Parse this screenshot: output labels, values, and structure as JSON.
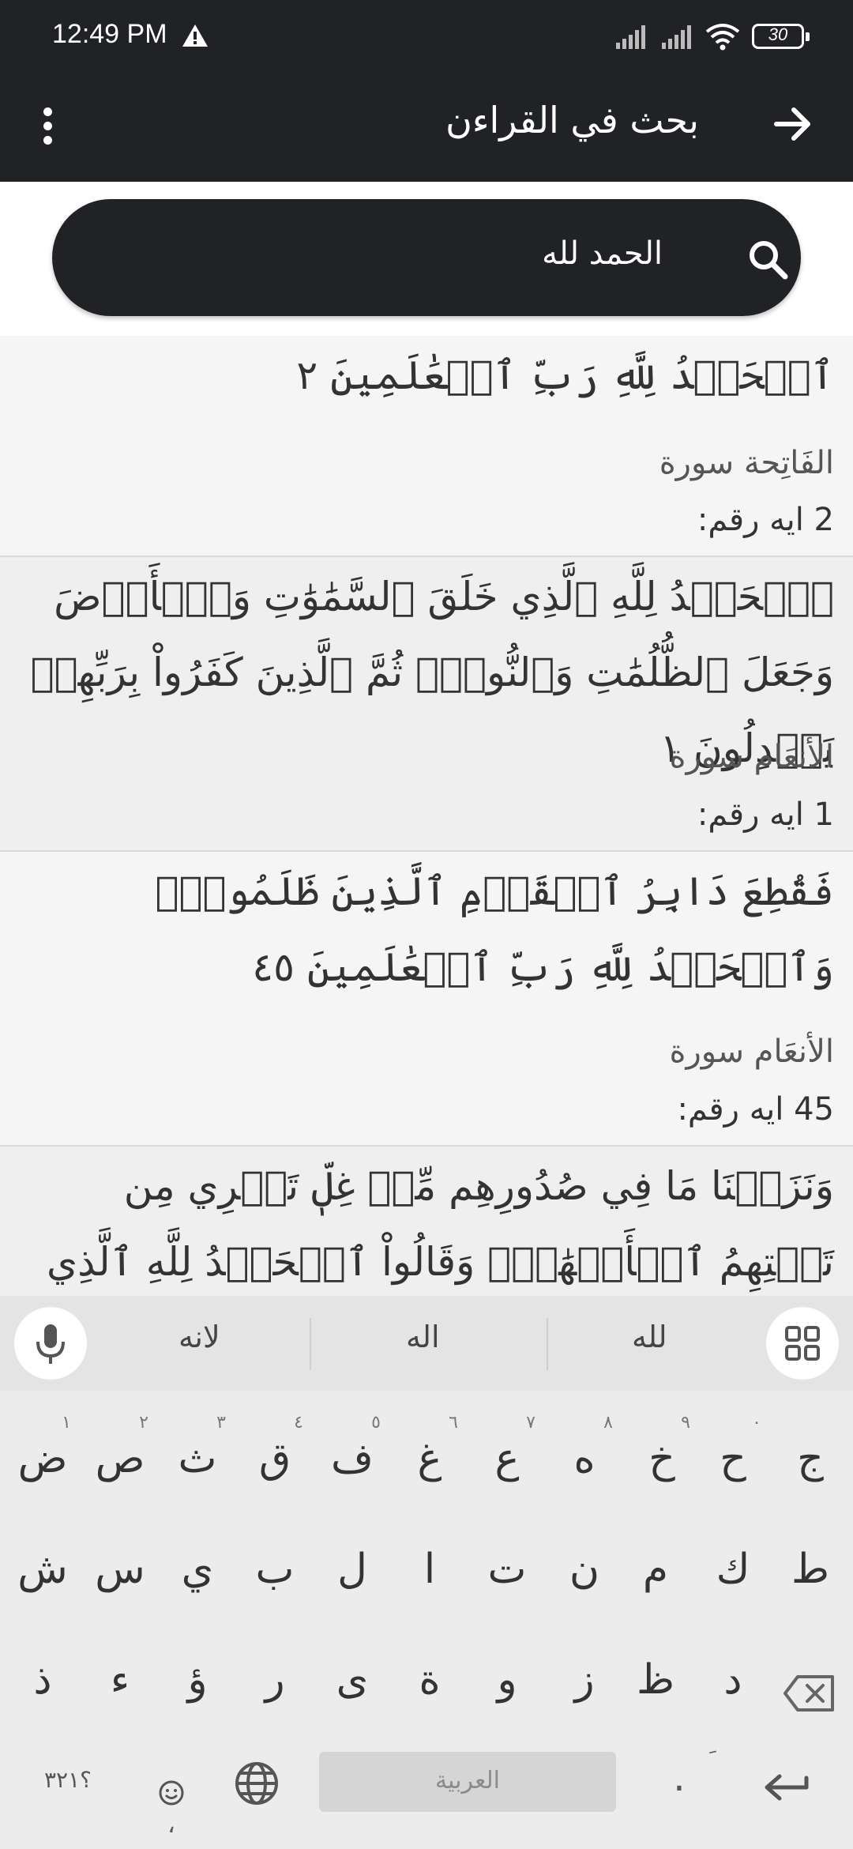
{
  "status_bar": {
    "time": "12:49 PM",
    "battery": "30",
    "icons": [
      "warning-icon",
      "signal-icon",
      "signal-icon",
      "wifi-icon",
      "battery-icon"
    ]
  },
  "app_bar": {
    "title": "بحث في القراءن",
    "icons": {
      "menu": "more-vert-icon",
      "back": "arrow-icon"
    }
  },
  "search": {
    "value": "الحمد لله",
    "icon": "search-icon"
  },
  "results": [
    {
      "verse": "ٱلۡحَمۡدُ لِلَّهِ رَبِّ ٱلۡعَٰلَمِينَ ٢",
      "surah": "الفَاتِحة سورة",
      "aya": "2 ايه رقم:"
    },
    {
      "verse": "ٱلۡحَمۡدُ لِلَّهِ ٱلَّذِي خَلَقَ ٱلسَّمَٰوَٰتِ وَٱلۡأَرۡضَ وَجَعَلَ ٱلظُّلُمَٰتِ وَٱلنُّورَۖ ثُمَّ ٱلَّذِينَ كَفَرُواْ بِرَبِّهِمۡ يَعۡدِلُونَ ١",
      "surah": "الأنعَام سورة",
      "aya": "1 ايه رقم:"
    },
    {
      "verse": "فَقُطِعَ دَابِرُ ٱلۡقَوۡمِ ٱلَّذِينَ ظَلَمُواْۚ وَٱلۡحَمۡدُ لِلَّهِ رَبِّ ٱلۡعَٰلَمِينَ ٤٥",
      "surah": "الأنعَام سورة",
      "aya": "45 ايه رقم:"
    },
    {
      "verse": "وَنَزَعۡنَا مَا فِي صُدُورِهِم مِّنۡ غِلّٖ تَجۡرِي مِن تَحۡتِهِمُ ٱلۡأَنۡهَٰرُۖ وَقَالُواْ ٱلۡحَمۡدُ لِلَّهِ ٱلَّذِي هَدَىٰنَا"
    }
  ],
  "keyboard": {
    "suggestions": [
      "لانه",
      "اله",
      "لله"
    ],
    "row1": [
      {
        "key": "ض",
        "hint": "١"
      },
      {
        "key": "ص",
        "hint": "٢"
      },
      {
        "key": "ث",
        "hint": "٣"
      },
      {
        "key": "ق",
        "hint": "٤"
      },
      {
        "key": "ف",
        "hint": "٥"
      },
      {
        "key": "غ",
        "hint": "٦"
      },
      {
        "key": "ع",
        "hint": "٧"
      },
      {
        "key": "ه",
        "hint": "٨"
      },
      {
        "key": "خ",
        "hint": "٩"
      },
      {
        "key": "ح",
        "hint": "٠"
      },
      {
        "key": "ج",
        "hint": ""
      }
    ],
    "row2": [
      "ش",
      "س",
      "ي",
      "ب",
      "ل",
      "ا",
      "ت",
      "ن",
      "م",
      "ك",
      "ط"
    ],
    "row3": [
      "ذ",
      "ء",
      "ؤ",
      "ر",
      "ى",
      "ة",
      "و",
      "ز",
      "ظ",
      "د"
    ],
    "numbers_key": "؟٣٢١",
    "comma_key": "،",
    "space_label": "العربية",
    "period_key": ".",
    "period_hint": "ِ"
  }
}
